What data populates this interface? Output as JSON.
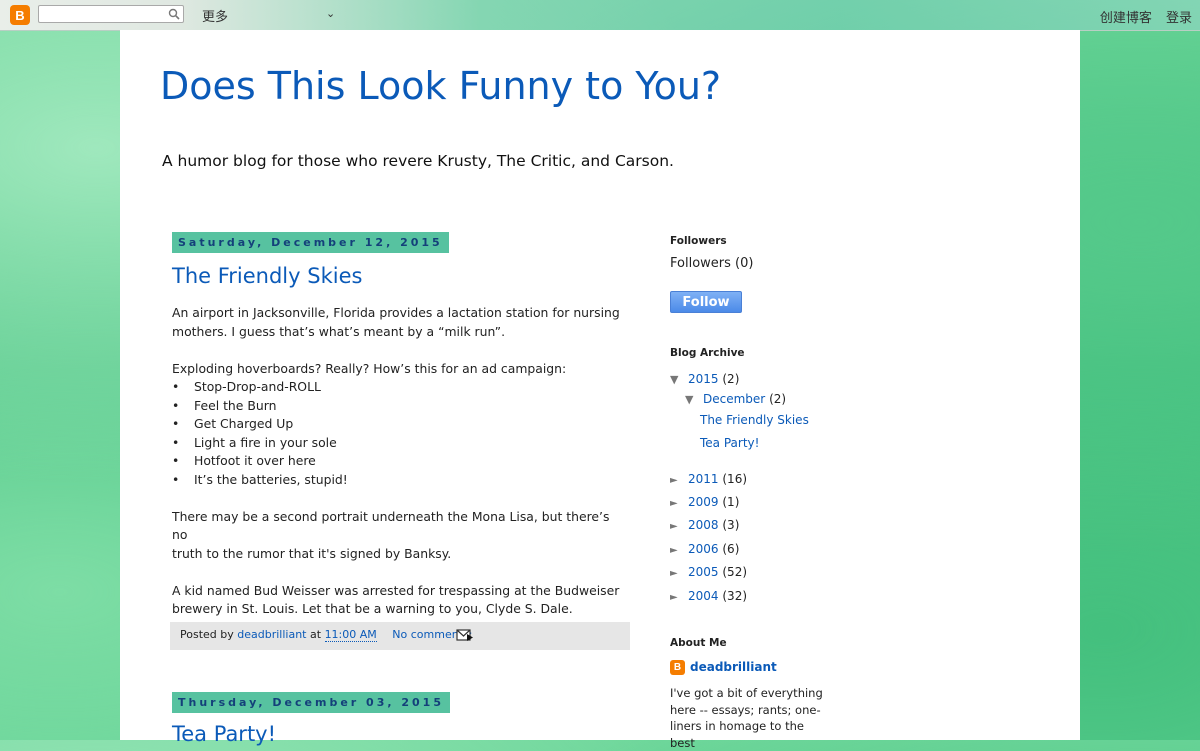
{
  "navbar": {
    "logo_letter": "B",
    "search_value": "",
    "more_label": "更多",
    "create_blog": "创建博客",
    "login": "登录"
  },
  "blog": {
    "title": "Does This Look Funny to You?",
    "description": "A humor blog for those who revere Krusty, The Critic, and Carson."
  },
  "posts": [
    {
      "date": "Saturday, December 12, 2015",
      "title": "The Friendly Skies",
      "para1_line1": "An airport in Jacksonville, Florida provides a lactation station for nursing",
      "para1_line2": "mothers.  I guess that’s what’s meant by a “milk run”.",
      "para2_intro": "Exploding hoverboards?  Really?  How’s this for an ad campaign:",
      "bullets": [
        "Stop-Drop-and-ROLL",
        "Feel the Burn",
        "Get Charged Up",
        "Light a fire in your sole",
        "Hotfoot it over here",
        "It’s the batteries, stupid!"
      ],
      "para3_line1": "There may be a second portrait underneath the Mona Lisa, but there’s no",
      "para3_line2": "truth to the rumor that it's signed by Banksy.",
      "para4_line1": "A kid named Bud Weisser was arrested for trespassing at the Budweiser",
      "para4_line2": "brewery in St. Louis.  Let that be a warning to you, Clyde S. Dale.",
      "footer": {
        "posted_by": "Posted by",
        "author": "deadbrilliant",
        "at": "at",
        "time": "11:00 AM",
        "comments": "No comments:"
      }
    },
    {
      "date": "Thursday, December 03, 2015",
      "title": "Tea Party!"
    }
  ],
  "sidebar": {
    "followers": {
      "title": "Followers",
      "count_label": "Followers (0)",
      "follow_button": "Follow"
    },
    "archive": {
      "title": "Blog Archive",
      "years": [
        {
          "year": "2015",
          "count": "(2)"
        },
        {
          "year": "2011",
          "count": "(16)"
        },
        {
          "year": "2009",
          "count": "(1)"
        },
        {
          "year": "2008",
          "count": "(3)"
        },
        {
          "year": "2006",
          "count": "(6)"
        },
        {
          "year": "2005",
          "count": "(52)"
        },
        {
          "year": "2004",
          "count": "(32)"
        }
      ],
      "month": {
        "name": "December",
        "count": "(2)"
      },
      "month_posts": [
        "The Friendly Skies",
        "Tea Party!"
      ]
    },
    "about": {
      "title": "About Me",
      "name": "deadbrilliant",
      "line1": "I've got a bit of everything",
      "line2": "here -- essays; rants; one-",
      "line3": "liners in homage to the best"
    }
  },
  "colors": {
    "link": "#0b5ab8",
    "date_header_bg": "#57c2a0",
    "blogger_orange": "#f57d00"
  }
}
